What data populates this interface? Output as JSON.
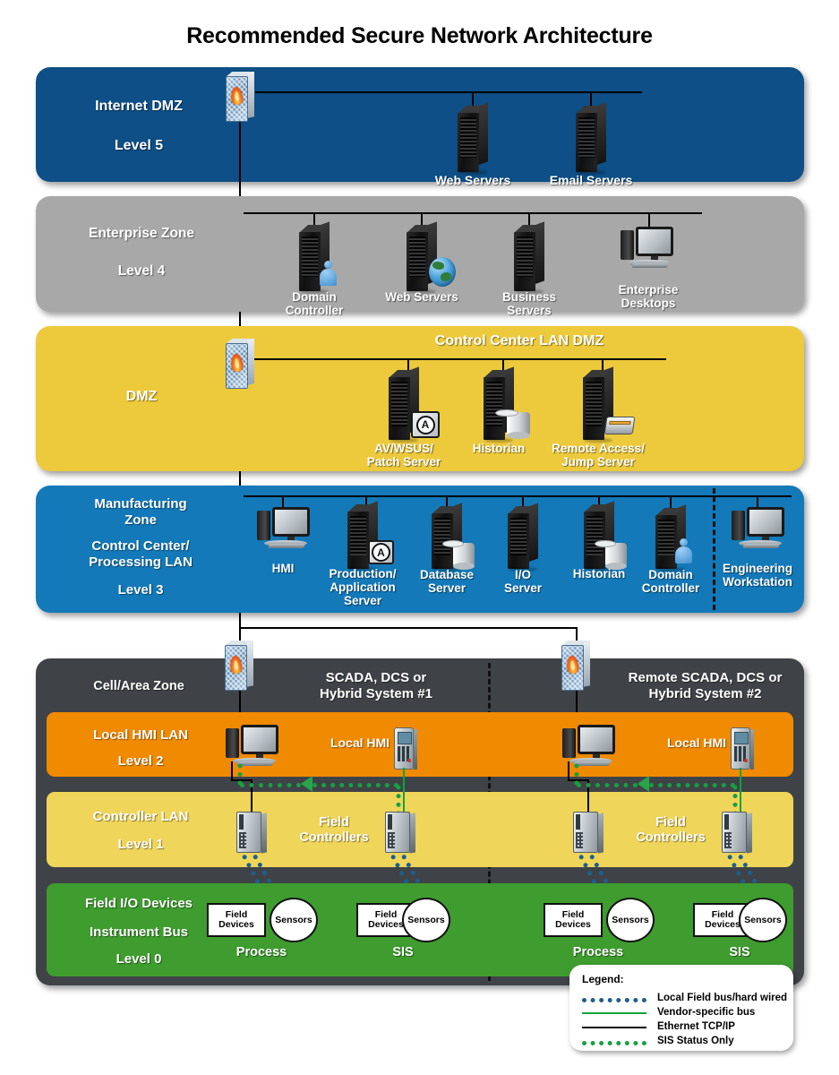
{
  "title": "Recommended Secure Network Architecture",
  "zones": {
    "internet_dmz": {
      "label_line1": "Internet DMZ",
      "label_line2": "Level 5",
      "color": "#0d4f86",
      "nodes": [
        {
          "name": "web-servers",
          "label": "Web Servers",
          "icon": "server-rack-icon"
        },
        {
          "name": "email-servers",
          "label": "Email Servers",
          "icon": "server-rack-icon"
        }
      ],
      "firewall": "firewall-icon"
    },
    "enterprise": {
      "label_line1": "Enterprise Zone",
      "label_line2": "Level 4",
      "color": "#a8a8a8",
      "nodes": [
        {
          "name": "domain-controller",
          "label_line1": "Domain",
          "label_line2": "Controller",
          "icon": "server-rack-user-icon"
        },
        {
          "name": "web-servers",
          "label_line1": "Web Servers",
          "label_line2": "",
          "icon": "server-rack-globe-icon"
        },
        {
          "name": "business-servers",
          "label_line1": "Business",
          "label_line2": "Servers",
          "icon": "server-rack-icon"
        },
        {
          "name": "enterprise-desktops",
          "label_line1": "Enterprise",
          "label_line2": "Desktops",
          "icon": "desktop-computer-icon"
        }
      ]
    },
    "dmz": {
      "label": "DMZ",
      "banner": "Control Center LAN DMZ",
      "color": "#edca3c",
      "firewall": "firewall-icon",
      "nodes": [
        {
          "name": "av-wsus-patch-server",
          "label_line1": "AV/WSUS/",
          "label_line2": "Patch Server",
          "icon": "server-rack-antivirus-icon"
        },
        {
          "name": "historian",
          "label_line1": "Historian",
          "label_line2": "",
          "icon": "server-rack-database-icon"
        },
        {
          "name": "remote-access-jump-server",
          "label_line1": "Remote Access/",
          "label_line2": "Jump Server",
          "icon": "server-rack-tape-icon"
        }
      ]
    },
    "manufacturing": {
      "label_line1": "Manufacturing",
      "label_line2": "Zone",
      "label_line3": "Control Center/",
      "label_line4": "Processing LAN",
      "label_line5": "Level 3",
      "color": "#1379b8",
      "nodes": [
        {
          "name": "hmi",
          "label_line1": "HMI",
          "label_line2": "",
          "label_line3": "",
          "icon": "desktop-computer-icon"
        },
        {
          "name": "production-application-server",
          "label_line1": "Production/",
          "label_line2": "Application",
          "label_line3": "Server",
          "icon": "server-rack-antivirus-icon"
        },
        {
          "name": "database-server",
          "label_line1": "Database",
          "label_line2": "Server",
          "label_line3": "",
          "icon": "server-rack-database-icon"
        },
        {
          "name": "io-server",
          "label_line1": "I/O",
          "label_line2": "Server",
          "label_line3": "",
          "icon": "server-rack-icon"
        },
        {
          "name": "historian",
          "label_line1": "Historian",
          "label_line2": "",
          "label_line3": "",
          "icon": "server-rack-database-icon"
        },
        {
          "name": "domain-controller",
          "label_line1": "Domain",
          "label_line2": "Controller",
          "label_line3": "",
          "icon": "server-rack-user-icon"
        },
        {
          "name": "engineering-workstation",
          "label_line1": "Engineering",
          "label_line2": "Workstation",
          "label_line3": "",
          "icon": "desktop-computer-icon"
        }
      ]
    },
    "cell_area": {
      "label": "Cell/Area Zone",
      "color": "#3f4347",
      "systems": [
        {
          "name": "scada-system-1",
          "label_line1": "SCADA, DCS or",
          "label_line2": "Hybrid System #1",
          "firewall": "firewall-icon"
        },
        {
          "name": "remote-scada-system-2",
          "label_line1": "Remote SCADA, DCS or",
          "label_line2": "Hybrid System #2",
          "firewall": "firewall-icon"
        }
      ],
      "bands": [
        {
          "name": "local-hmi-lan",
          "label_line1": "Local HMI LAN",
          "label_line2": "Level 2",
          "color": "#f08a00",
          "node_labels": [
            "Local HMI",
            "Local HMI"
          ]
        },
        {
          "name": "controller-lan",
          "label_line1": "Controller LAN",
          "label_line2": "Level 1",
          "color": "#efd559",
          "node_labels": [
            "Field\nControllers",
            "Field\nControllers"
          ],
          "node_label_a": "Field",
          "node_label_b": "Controllers"
        },
        {
          "name": "field-io-devices",
          "label_line1": "Field I/O Devices",
          "label_line2": "Instrument Bus",
          "label_line3": "Level 0",
          "color": "#3f9c2f",
          "groups": [
            {
              "group": "Process",
              "field_devices": "Field\nDevices",
              "sensors": "Sensors"
            },
            {
              "group": "SIS",
              "field_devices": "Field\nDevices",
              "sensors": "Sensors"
            },
            {
              "group": "Process",
              "field_devices": "Field\nDevices",
              "sensors": "Sensors"
            },
            {
              "group": "SIS",
              "field_devices": "Field\nDevices",
              "sensors": "Sensors"
            }
          ],
          "fd_line1": "Field",
          "fd_line2": "Devices",
          "sensor_label": "Sensors",
          "process_label": "Process",
          "sis_label": "SIS"
        }
      ]
    }
  },
  "legend": {
    "title": "Legend:",
    "items": [
      {
        "name": "local-field-bus",
        "label": "Local Field bus/hard wired",
        "style": "dotted",
        "color": "#1b5f8c"
      },
      {
        "name": "vendor-specific-bus",
        "label": "Vendor-specific bus",
        "style": "solid",
        "color": "#12a33f"
      },
      {
        "name": "ethernet-tcp-ip",
        "label": "Ethernet TCP/IP",
        "style": "solid",
        "color": "#000000"
      },
      {
        "name": "sis-status-only",
        "label": "SIS Status Only",
        "style": "dotted",
        "color": "#17a03f"
      }
    ]
  }
}
